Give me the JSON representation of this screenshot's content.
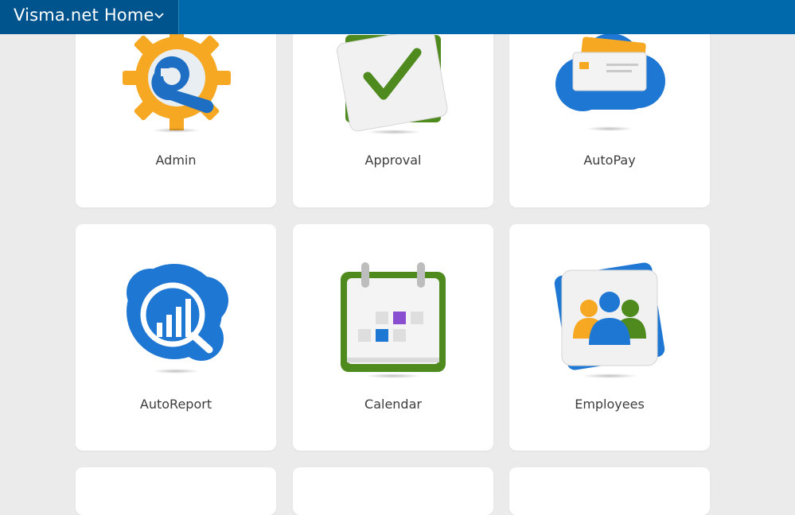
{
  "header": {
    "title": "Visma.net Home",
    "dropdown_icon": "chevron-down-icon"
  },
  "apps": [
    {
      "label": "Admin",
      "icon": "admin-gear-wrench-icon"
    },
    {
      "label": "Approval",
      "icon": "approval-checkmark-icon"
    },
    {
      "label": "AutoPay",
      "icon": "autopay-cloud-cards-icon"
    },
    {
      "label": "AutoReport",
      "icon": "autoreport-magnifier-chart-icon"
    },
    {
      "label": "Calendar",
      "icon": "calendar-icon"
    },
    {
      "label": "Employees",
      "icon": "employees-people-icon"
    }
  ],
  "colors": {
    "header_bar": "#0069ab",
    "home_button": "#00548e",
    "background": "#ebebeb",
    "card": "#ffffff",
    "label_text": "#3c3c3c"
  }
}
